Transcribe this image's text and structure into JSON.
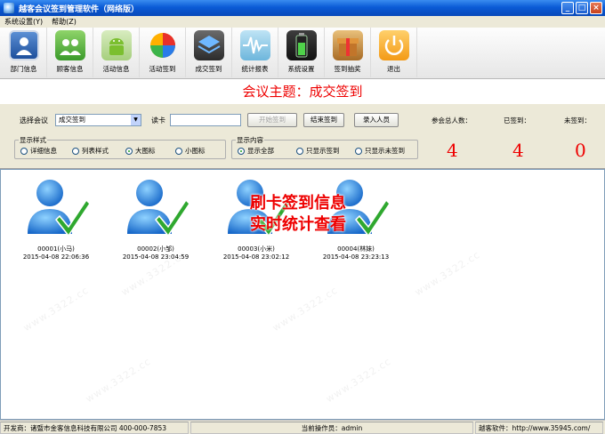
{
  "window": {
    "title": "越客会议签到管理软件（网络版）"
  },
  "menu": [
    "系统设置(Y)",
    "帮助(Z)"
  ],
  "toolbar": [
    {
      "label": "部门信息",
      "icon": "department-icon"
    },
    {
      "label": "顾客信息",
      "icon": "customer-icon"
    },
    {
      "label": "活动信息",
      "icon": "android-icon"
    },
    {
      "label": "活动签到",
      "icon": "colorful-ball-icon"
    },
    {
      "label": "成交签到",
      "icon": "layers-icon"
    },
    {
      "label": "统计报表",
      "icon": "waveform-icon"
    },
    {
      "label": "系统设置",
      "icon": "battery-icon"
    },
    {
      "label": "签到抽奖",
      "icon": "gift-box-icon"
    },
    {
      "label": "退出",
      "icon": "power-icon"
    }
  ],
  "meeting_title": "会议主题：成交签到",
  "controls": {
    "select_label": "选择会议",
    "selected_meeting": "成交签到",
    "card_label": "读卡",
    "start_button": "开始签到",
    "end_button": "结束签到",
    "enter_button": "录入人员",
    "display_style_title": "显示样式",
    "style_options": [
      "详细信息",
      "列表样式",
      "大图标",
      "小图标"
    ],
    "display_content_title": "显示内容",
    "content_options": [
      "显示全部",
      "只显示签到",
      "只显示未签到"
    ]
  },
  "stats": {
    "total_label": "参会总人数：",
    "total": "4",
    "signed_label": "已签到：",
    "signed": "4",
    "unsigned_label": "未签到：",
    "unsigned": "0"
  },
  "attendees": [
    {
      "name": "00001(小马)",
      "time": "2015-04-08 22:06:36"
    },
    {
      "name": "00002(小邹)",
      "time": "2015-04-08 23:04:59"
    },
    {
      "name": "00003(小米)",
      "time": "2015-04-08 23:02:12"
    },
    {
      "name": "00004(林妹)",
      "time": "2015-04-08 23:23:13"
    }
  ],
  "overlay": {
    "line1": "刷卡签到信息",
    "line2": "实时统计查看"
  },
  "watermark": "www.3322.cc",
  "status": {
    "developer": "开发商：诸暨市金客信息科技有限公司   400-000-7853",
    "operator": "当前操作员：admin",
    "website": "越客软件：http://www.35945.com/"
  },
  "colors": {
    "accent_red": "#e00000",
    "title_blue": "#0a5bd6",
    "check_green": "#2fa82f"
  }
}
